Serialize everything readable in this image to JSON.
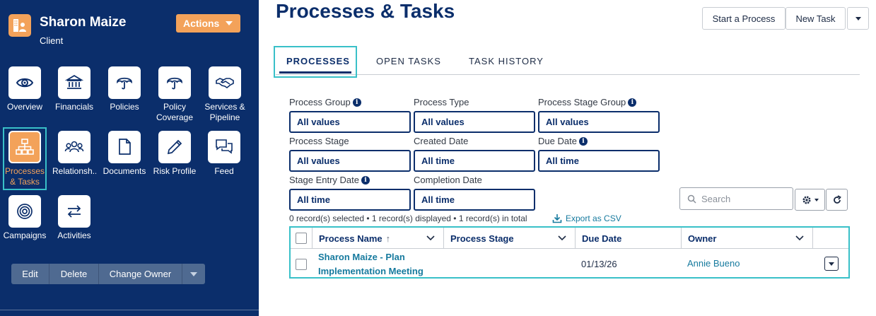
{
  "client": {
    "name": "Sharon Maize",
    "type": "Client",
    "actions_label": "Actions",
    "avatar_icon": "client-contact-icon"
  },
  "nav": [
    {
      "label": "Overview",
      "icon": "eye-icon"
    },
    {
      "label": "Financials",
      "icon": "bank-icon"
    },
    {
      "label": "Policies",
      "icon": "umbrella-icon"
    },
    {
      "label": "Policy Coverage",
      "icon": "umbrella-icon"
    },
    {
      "label": "Services & Pipeline",
      "icon": "handshake-icon"
    },
    {
      "label": "Processes & Tasks",
      "icon": "org-chart-icon",
      "active": true
    },
    {
      "label": "Relationsh...",
      "icon": "people-icon"
    },
    {
      "label": "Documents",
      "icon": "document-icon"
    },
    {
      "label": "Risk Profile",
      "icon": "pencil-icon"
    },
    {
      "label": "Feed",
      "icon": "chat-icon"
    },
    {
      "label": "Campaigns",
      "icon": "target-icon"
    },
    {
      "label": "Activities",
      "icon": "arrows-icon"
    }
  ],
  "record_buttons": {
    "edit": "Edit",
    "delete": "Delete",
    "change_owner": "Change Owner"
  },
  "page": {
    "title": "Processes & Tasks",
    "start_process": "Start a Process",
    "new_task": "New Task"
  },
  "tabs": [
    {
      "label": "PROCESSES",
      "active": true
    },
    {
      "label": "OPEN TASKS"
    },
    {
      "label": "TASK HISTORY"
    }
  ],
  "filters": [
    {
      "label": "Process Group",
      "value": "All values",
      "info": true
    },
    {
      "label": "Process Type",
      "value": "All values",
      "info": false
    },
    {
      "label": "Process Stage Group",
      "value": "All values",
      "info": true
    },
    {
      "label": "Process Stage",
      "value": "All values",
      "info": false
    },
    {
      "label": "Created Date",
      "value": "All time",
      "info": false
    },
    {
      "label": "Due Date",
      "value": "All time",
      "info": true
    },
    {
      "label": "Stage Entry Date",
      "value": "All time",
      "info": true
    },
    {
      "label": "Completion Date",
      "value": "All time",
      "info": false
    }
  ],
  "search": {
    "placeholder": "Search"
  },
  "records_summary": "0 record(s) selected • 1 record(s) displayed • 1 record(s) in total",
  "export_label": "Export as CSV",
  "table": {
    "columns": [
      "Process Name",
      "Process Stage",
      "Due Date",
      "Owner"
    ],
    "sort_indicator": "↑",
    "rows": [
      {
        "process_name": "Sharon Maize - Plan Implementation Meeting",
        "process_stage": "",
        "due_date": "01/13/26",
        "owner": "Annie Bueno"
      }
    ]
  },
  "colors": {
    "sidebar_bg": "#0b2e6b",
    "accent_orange": "#f3a25a",
    "link_teal": "#167a9e",
    "highlight": "#39c0c8"
  }
}
